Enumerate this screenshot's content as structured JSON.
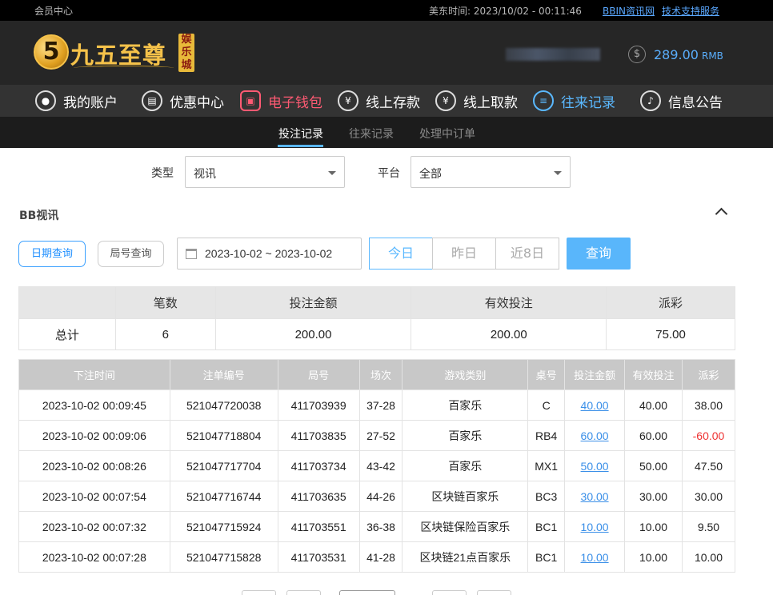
{
  "topbar": {
    "member_center": "会员中心",
    "time_label": "美东时间: 2023/10/02 - 00:11:46",
    "link_news": "BBIN资讯网",
    "link_support": "技术支持服务"
  },
  "header": {
    "logo_mark": "5",
    "logo_name": "九五至尊",
    "logo_tag": "娱乐城",
    "balance": "289.00",
    "currency": "RMB",
    "wallet_icon": "dollar-circle-icon"
  },
  "nav": [
    {
      "label": "我的账户",
      "icon": "user-icon"
    },
    {
      "label": "优惠中心",
      "icon": "gift-icon"
    },
    {
      "label": "电子钱包",
      "icon": "wallet-icon"
    },
    {
      "label": "线上存款",
      "icon": "deposit-icon"
    },
    {
      "label": "线上取款",
      "icon": "withdraw-icon"
    },
    {
      "label": "往来记录",
      "icon": "record-icon"
    },
    {
      "label": "信息公告",
      "icon": "bell-icon"
    }
  ],
  "subnav": {
    "tab1": "投注记录",
    "tab2": "往来记录",
    "tab3": "处理中订单"
  },
  "filters": {
    "type_label": "类型",
    "type_value": "视讯",
    "platform_label": "平台",
    "platform_value": "全部"
  },
  "section": {
    "title": "BB视讯",
    "date_query": "日期查询",
    "round_query": "局号查询",
    "date_range": "2023-10-02 ~ 2023-10-02",
    "today": "今日",
    "yesterday": "昨日",
    "last8": "近8日",
    "query": "查询"
  },
  "summary": {
    "headers": [
      "",
      "笔数",
      "投注金额",
      "有效投注",
      "派彩"
    ],
    "row": [
      "总计",
      "6",
      "200.00",
      "200.00",
      "75.00"
    ]
  },
  "details": {
    "headers": [
      "下注时间",
      "注单编号",
      "局号",
      "场次",
      "游戏类别",
      "桌号",
      "投注金额",
      "有效投注",
      "派彩"
    ],
    "rows": [
      [
        "2023-10-02 00:09:45",
        "521047720038",
        "411703939",
        "37-28",
        "百家乐",
        "C",
        "40.00",
        "40.00",
        "38.00"
      ],
      [
        "2023-10-02 00:09:06",
        "521047718804",
        "411703835",
        "27-52",
        "百家乐",
        "RB4",
        "60.00",
        "60.00",
        "-60.00"
      ],
      [
        "2023-10-02 00:08:26",
        "521047717704",
        "411703734",
        "43-42",
        "百家乐",
        "MX1",
        "50.00",
        "50.00",
        "47.50"
      ],
      [
        "2023-10-02 00:07:54",
        "521047716744",
        "411703635",
        "44-26",
        "区块链百家乐",
        "BC3",
        "30.00",
        "30.00",
        "30.00"
      ],
      [
        "2023-10-02 00:07:32",
        "521047715924",
        "411703551",
        "36-38",
        "区块链保险百家乐",
        "BC1",
        "10.00",
        "10.00",
        "9.50"
      ],
      [
        "2023-10-02 00:07:28",
        "521047715828",
        "411703531",
        "41-28",
        "区块链21点百家乐",
        "BC1",
        "10.00",
        "10.00",
        "10.00"
      ]
    ]
  }
}
